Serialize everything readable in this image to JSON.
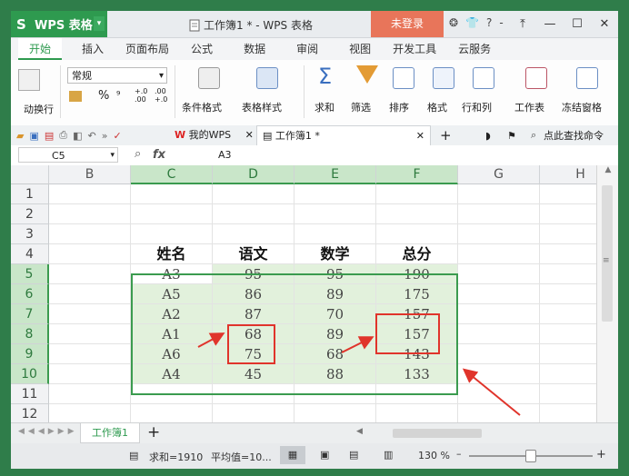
{
  "app": {
    "name": "WPS 表格",
    "logo_letter": "S",
    "document_title": "工作簿1 * - WPS 表格",
    "login_label": "未登录"
  },
  "window_controls": {
    "minimize": "—",
    "maximize": "☐",
    "close": "✕"
  },
  "title_icons": [
    "?",
    "-"
  ],
  "menu_tabs": [
    "开始",
    "插入",
    "页面布局",
    "公式",
    "数据",
    "审阅",
    "视图",
    "开发工具",
    "云服务"
  ],
  "ribbon": {
    "wrap_label": "动换行",
    "format_combo": "常规",
    "percent": "%",
    "thousands": "⁹",
    "dec_inc": "+.0 .00",
    "dec_dec": ".00 +.0",
    "buttons": [
      "条件格式",
      "表格样式",
      "求和",
      "筛选",
      "排序",
      "格式",
      "行和列",
      "工作表",
      "冻结窗格"
    ]
  },
  "quickbar": {
    "my_wps": "我的WPS",
    "doc_tab": "工作簿1 *",
    "search_label": "点此查找命令",
    "add_tab": "+"
  },
  "formula_bar": {
    "name_box": "C5",
    "fx": "fx",
    "value": "A3"
  },
  "grid": {
    "columns": [
      "B",
      "C",
      "D",
      "E",
      "F",
      "G",
      "H"
    ],
    "selected_columns": [
      "C",
      "D",
      "E",
      "F"
    ],
    "rows": [
      "1",
      "2",
      "3",
      "4",
      "5",
      "6",
      "7",
      "8",
      "9",
      "10",
      "11",
      "12"
    ],
    "selected_rows": [
      "5",
      "6",
      "7",
      "8",
      "9",
      "10"
    ],
    "header_row": [
      "姓名",
      "语文",
      "数学",
      "总分"
    ],
    "data_rows": [
      [
        "A3",
        "95",
        "95",
        "190"
      ],
      [
        "A5",
        "86",
        "89",
        "175"
      ],
      [
        "A2",
        "87",
        "70",
        "157"
      ],
      [
        "A1",
        "68",
        "89",
        "157"
      ],
      [
        "A6",
        "75",
        "68",
        "143"
      ],
      [
        "A4",
        "45",
        "88",
        "133"
      ]
    ]
  },
  "sheets": {
    "active": "工作簿1",
    "add": "+"
  },
  "status": {
    "sum": "求和=1910",
    "average": "平均值=10...",
    "zoom": "130 %",
    "zoom_minus": "–",
    "zoom_plus": "+"
  },
  "colors": {
    "brand_green": "#2e9a4f",
    "selection_green": "#3b9b4f",
    "highlight": "#e2f1dc",
    "annotation_red": "#e0342b"
  }
}
